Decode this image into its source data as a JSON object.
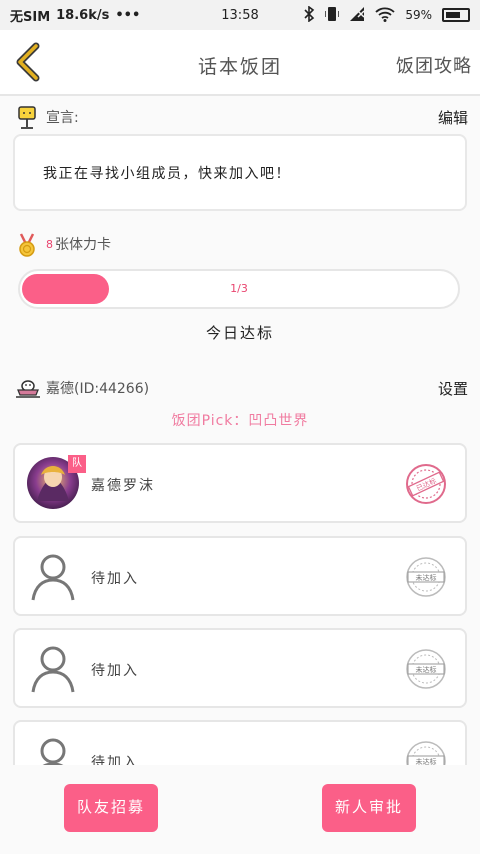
{
  "status_bar": {
    "carrier": "无SIM",
    "speed": "18.6k/s",
    "dots": "•••",
    "time": "13:58",
    "battery_percent": "59%"
  },
  "header": {
    "title": "话本饭团",
    "guide_link": "饭团攻略"
  },
  "announcement": {
    "label": "宣言:",
    "edit_label": "编辑",
    "text": "我正在寻找小组成员，快来加入吧！"
  },
  "stamina": {
    "count": "8",
    "label": "张体力卡"
  },
  "progress": {
    "current": 1,
    "total": 3,
    "text": "1/3",
    "fraction": 0.2,
    "caption": "今日达标"
  },
  "group": {
    "owner": "嘉德(ID:44266)",
    "settings_label": "设置",
    "pick": "饭团Pick：凹凸世界"
  },
  "members": [
    {
      "name": "嘉德罗沫",
      "badge": "队",
      "status": "已达标",
      "joined": true
    },
    {
      "name": "待加入",
      "status": "未达标",
      "joined": false
    },
    {
      "name": "待加入",
      "status": "未达标",
      "joined": false
    },
    {
      "name": "待加入",
      "status": "未达标",
      "joined": false
    }
  ],
  "actions": {
    "recruit": "队友招募",
    "approve": "新人审批"
  },
  "colors": {
    "accent": "#fb5f88",
    "back_arrow": "#d9a51d"
  }
}
